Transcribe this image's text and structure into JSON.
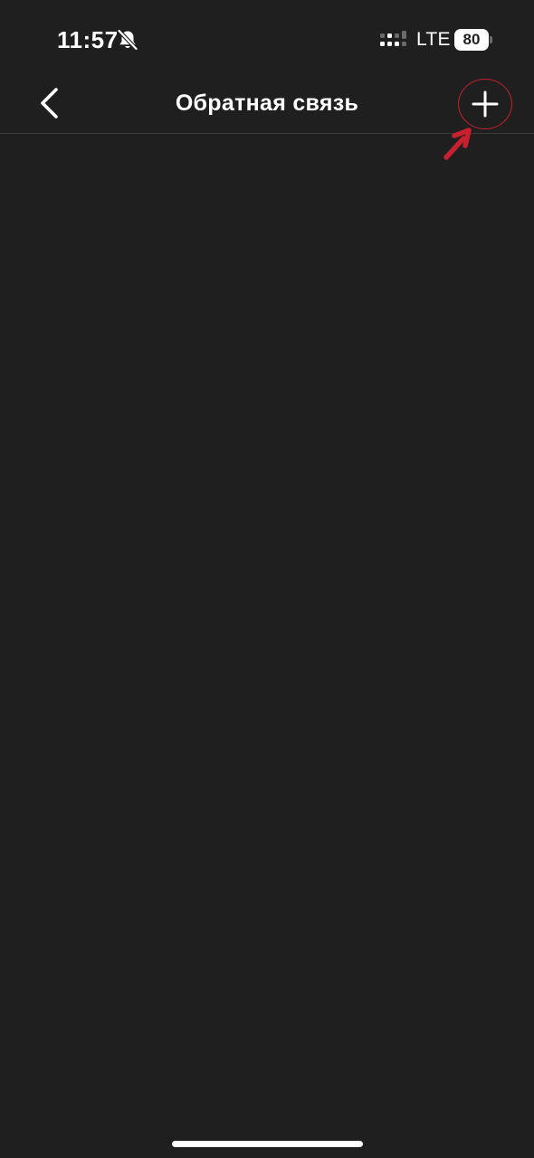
{
  "status_bar": {
    "time": "11:57",
    "network": "LTE",
    "battery": "80",
    "icons": {
      "bell": "bell-slash-icon",
      "signal": "signal-icon"
    }
  },
  "nav": {
    "title": "Обратная связь",
    "icons": {
      "back": "chevron-left-icon",
      "add": "plus-icon"
    }
  },
  "annotation": {
    "color": "#c8202f",
    "icons": {
      "circle": "highlight-circle",
      "arrow": "arrow-pointer-icon"
    }
  },
  "colors": {
    "background": "#1f1f1f",
    "text": "#ffffff",
    "divider": "#3a3a3a"
  }
}
